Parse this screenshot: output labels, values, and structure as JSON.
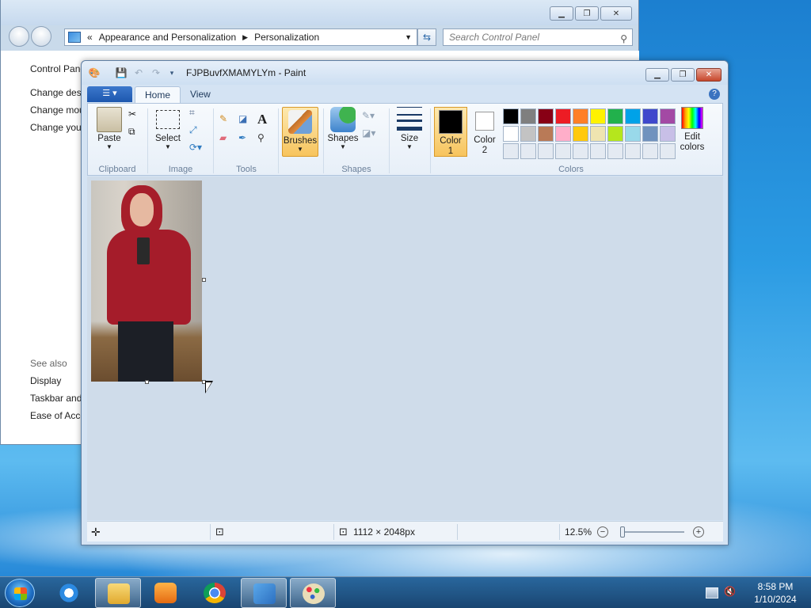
{
  "control_panel": {
    "breadcrumb": [
      "Appearance and Personalization",
      "Personalization"
    ],
    "breadcrumb_sep": "«",
    "search_placeholder": "Search Control Panel",
    "left_title": "Control Panel",
    "left_links": [
      "Change desk",
      "Change mou",
      "Change you"
    ],
    "see_also_header": "See also",
    "see_also_links": [
      "Display",
      "Taskbar and",
      "Ease of Acce"
    ]
  },
  "paint": {
    "title": "FJPBuvfXMAMYLYm - Paint",
    "tabs": {
      "home": "Home",
      "view": "View"
    },
    "groups": {
      "clipboard": "Clipboard",
      "image": "Image",
      "tools": "Tools",
      "shapes": "Shapes",
      "colors": "Colors"
    },
    "buttons": {
      "paste": "Paste",
      "select": "Select",
      "brushes": "Brushes",
      "shapes": "Shapes",
      "size": "Size",
      "color1": "Color",
      "color1_num": "1",
      "color2": "Color",
      "color2_num": "2",
      "edit_colors_1": "Edit",
      "edit_colors_2": "colors"
    },
    "color1_value": "#000000",
    "color2_value": "#ffffff",
    "palette": [
      "#000000",
      "#7f7f7f",
      "#880015",
      "#ed1c24",
      "#ff7f27",
      "#fff200",
      "#22b14c",
      "#00a2e8",
      "#3f48cc",
      "#a349a4",
      "#ffffff",
      "#c3c3c3",
      "#b97a57",
      "#ffaec9",
      "#ffc90e",
      "#efe4b0",
      "#b5e61d",
      "#99d9ea",
      "#7092be",
      "#c8bfe7",
      "#e4eaf2",
      "#e4eaf2",
      "#e4eaf2",
      "#e4eaf2",
      "#e4eaf2",
      "#e4eaf2",
      "#e4eaf2",
      "#e4eaf2",
      "#e4eaf2",
      "#e4eaf2"
    ],
    "status": {
      "image_size": "1112 × 2048px",
      "zoom": "12.5%",
      "zoom_fraction": 0.03
    }
  },
  "taskbar": {
    "time": "8:58 PM",
    "date": "1/10/2024"
  }
}
